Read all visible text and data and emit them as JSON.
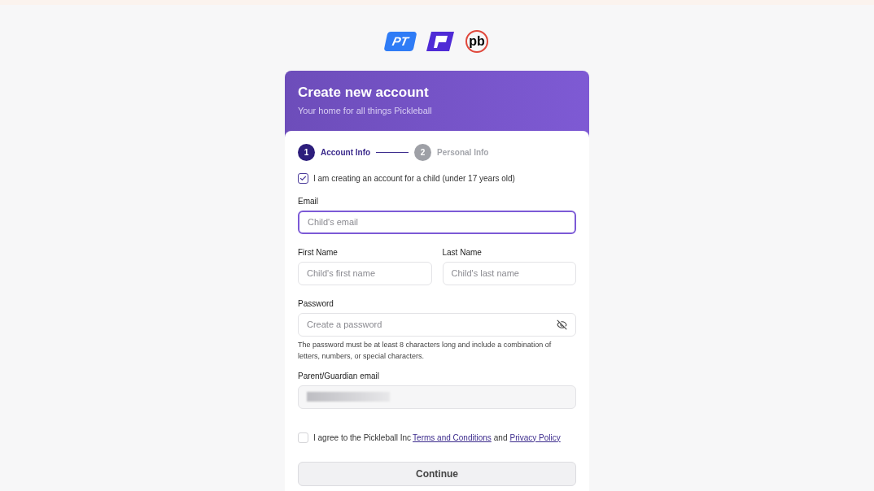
{
  "logos": [
    {
      "kind": "pt",
      "text": "PT"
    },
    {
      "kind": "bars"
    },
    {
      "kind": "pb",
      "text": "pb"
    }
  ],
  "header": {
    "title": "Create new account",
    "subtitle": "Your home for all things Pickleball"
  },
  "steps": [
    {
      "number": "1",
      "label": "Account Info",
      "selected": true
    },
    {
      "number": "2",
      "label": "Personal Info",
      "selected": false
    }
  ],
  "child_checkbox": {
    "label": "I am creating an account for a child (under 17 years old)",
    "checked": true
  },
  "email": {
    "label": "Email",
    "placeholder": "Child's email",
    "focused": true
  },
  "first_name": {
    "label": "First Name",
    "placeholder": "Child's first name"
  },
  "last_name": {
    "label": "Last Name",
    "placeholder": "Child's last name"
  },
  "password": {
    "label": "Password",
    "placeholder": "Create a password",
    "hint": "The password must be at least 8 characters long and include a combination of letters, numbers, or special characters."
  },
  "guardian_email": {
    "label": "Parent/Guardian email",
    "value_blurred": true
  },
  "terms": {
    "checked": false,
    "before": "I agree to the Pickleball Inc",
    "link1": "Terms and Conditions",
    "middle": "and",
    "link2": "Privacy Policy"
  },
  "continue_button": "Continue"
}
